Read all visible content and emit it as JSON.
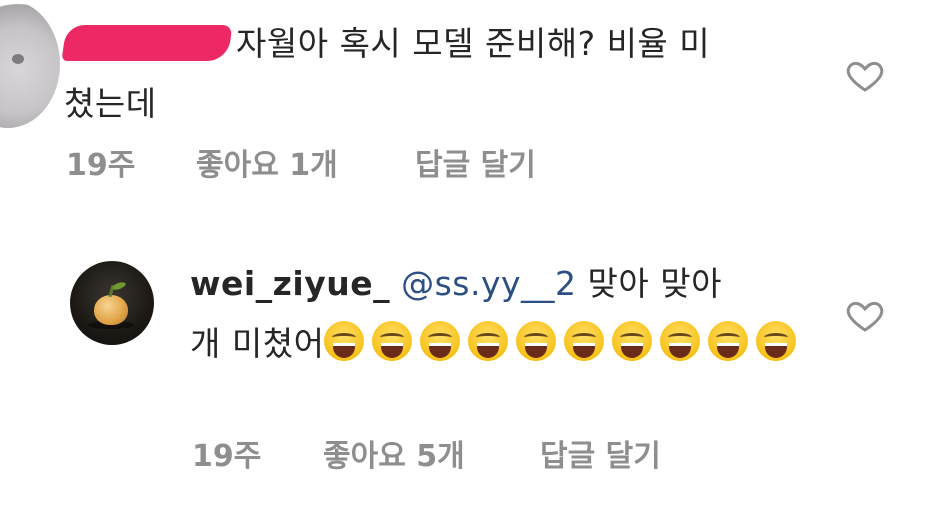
{
  "comments": [
    {
      "username_redacted": true,
      "text_line1": "자월아 혹시 모델 준비해? 비율 미",
      "text_line2": "쳤는데",
      "time": "19주",
      "likes": "좋아요 1개",
      "reply": "답글 달기",
      "like_icon": "heart-outline-icon"
    },
    {
      "username": "wei_ziyue_",
      "mention": "@ss.yy__2",
      "text_part1": "맞아 맞아",
      "text_part2": "개 미쳤어",
      "emoji_name": "laughing-tears-emoji",
      "emoji_count": 10,
      "time": "19주",
      "likes": "좋아요 5개",
      "reply": "답글 달기",
      "like_icon": "heart-outline-icon"
    }
  ],
  "colors": {
    "text": "#262626",
    "meta": "#8e8e8e",
    "mention": "#2b4f82",
    "redaction": "#ec2865"
  }
}
